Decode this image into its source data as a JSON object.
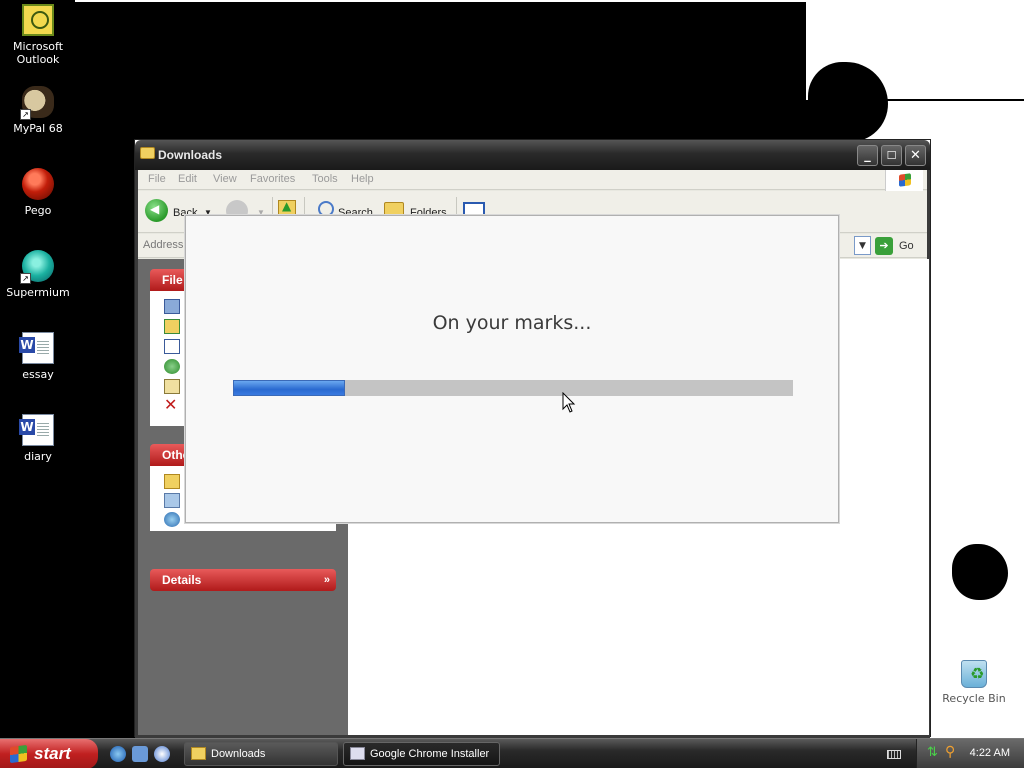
{
  "desktop": {
    "icons": [
      {
        "label": "Microsoft Outlook",
        "icon": "outlook-icon"
      },
      {
        "label": "MyPal 68",
        "icon": "mypal-icon"
      },
      {
        "label": "Pego",
        "icon": "pego-icon"
      },
      {
        "label": "Supermium",
        "icon": "supermium-icon"
      },
      {
        "label": "essay",
        "icon": "word-document-icon"
      },
      {
        "label": "diary",
        "icon": "word-document-icon"
      },
      {
        "label": "Recycle Bin",
        "icon": "recycle-bin-icon"
      }
    ]
  },
  "explorer": {
    "title": "Downloads",
    "menu": [
      "File",
      "Edit",
      "View",
      "Favorites",
      "Tools",
      "Help"
    ],
    "toolbar": {
      "back": "Back",
      "search": "Search",
      "folders": "Folders"
    },
    "address": {
      "label": "Address",
      "go": "Go"
    },
    "panels": [
      {
        "title": "File"
      },
      {
        "title": "Othe"
      },
      {
        "title": "Details"
      }
    ]
  },
  "installer": {
    "message": "On your marks...",
    "progress_fraction": 0.2
  },
  "taskbar": {
    "start_label": "start",
    "tasks": [
      {
        "label": "Downloads",
        "icon": "folder-icon",
        "active": false
      },
      {
        "label": "Google Chrome Installer",
        "icon": "chrome-installer-icon",
        "active": true
      }
    ],
    "clock": "4:22 AM"
  },
  "colors": {
    "titlebar": "#2a2a2a",
    "panel_header": "#c82828",
    "progress": "#2a6ad0",
    "start_button": "#c02020"
  }
}
